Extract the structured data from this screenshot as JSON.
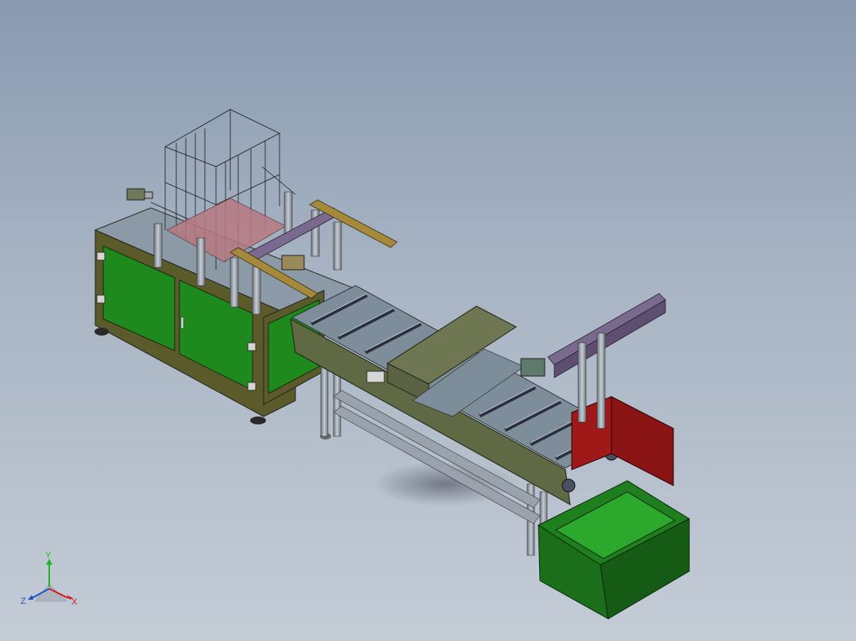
{
  "viewport": {
    "background_top": "#8a9ab0",
    "background_bottom": "#c4ccd6"
  },
  "colors": {
    "cabinet_panel": "#1e8a1e",
    "cabinet_frame": "#5b5a2a",
    "conveyor_side": "#5f6a44",
    "frame_steel": "#9aa3ad",
    "guide_purple": "#7b6a8f",
    "guide_gold": "#a48a3a",
    "tray_pink": "#b87a82",
    "bin_green": "#1f7f1f",
    "bin_red": "#8a1414",
    "y_axis": "#1fb81f",
    "x_axis": "#d11a1a",
    "z_axis": "#2050c8"
  },
  "icons": {
    "triad": "coordinate-triad-icon"
  },
  "triad": {
    "y_label": "Y",
    "z_label": "Z",
    "x_label": "X"
  }
}
